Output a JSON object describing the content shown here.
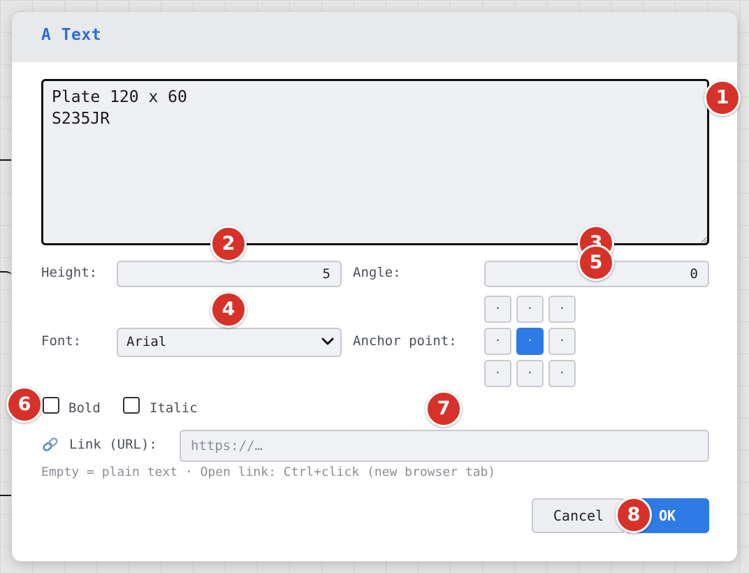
{
  "dialog": {
    "title": "A Text",
    "text_value": "Plate 120 x 60\nS235JR",
    "height": {
      "label": "Height:",
      "value": "5"
    },
    "angle": {
      "label": "Angle:",
      "value": "0"
    },
    "font": {
      "label": "Font:",
      "selected": "Arial"
    },
    "anchor": {
      "label": "Anchor point:",
      "cell_glyph": "·",
      "selected_index": 4
    },
    "bold": {
      "label": "Bold",
      "checked": false
    },
    "italic": {
      "label": "Italic",
      "checked": false
    },
    "link": {
      "label": "Link (URL):",
      "placeholder": "https://…",
      "icon": "link-icon"
    },
    "hint": "Empty = plain text · Open link: Ctrl+click (new browser tab)",
    "buttons": {
      "cancel": "Cancel",
      "ok": "OK"
    }
  },
  "markers": [
    "1",
    "2",
    "3",
    "4",
    "5",
    "6",
    "7",
    "8"
  ],
  "colors": {
    "accent": "#2f7be5",
    "title": "#2f6fd0",
    "marker": "#d63229"
  }
}
